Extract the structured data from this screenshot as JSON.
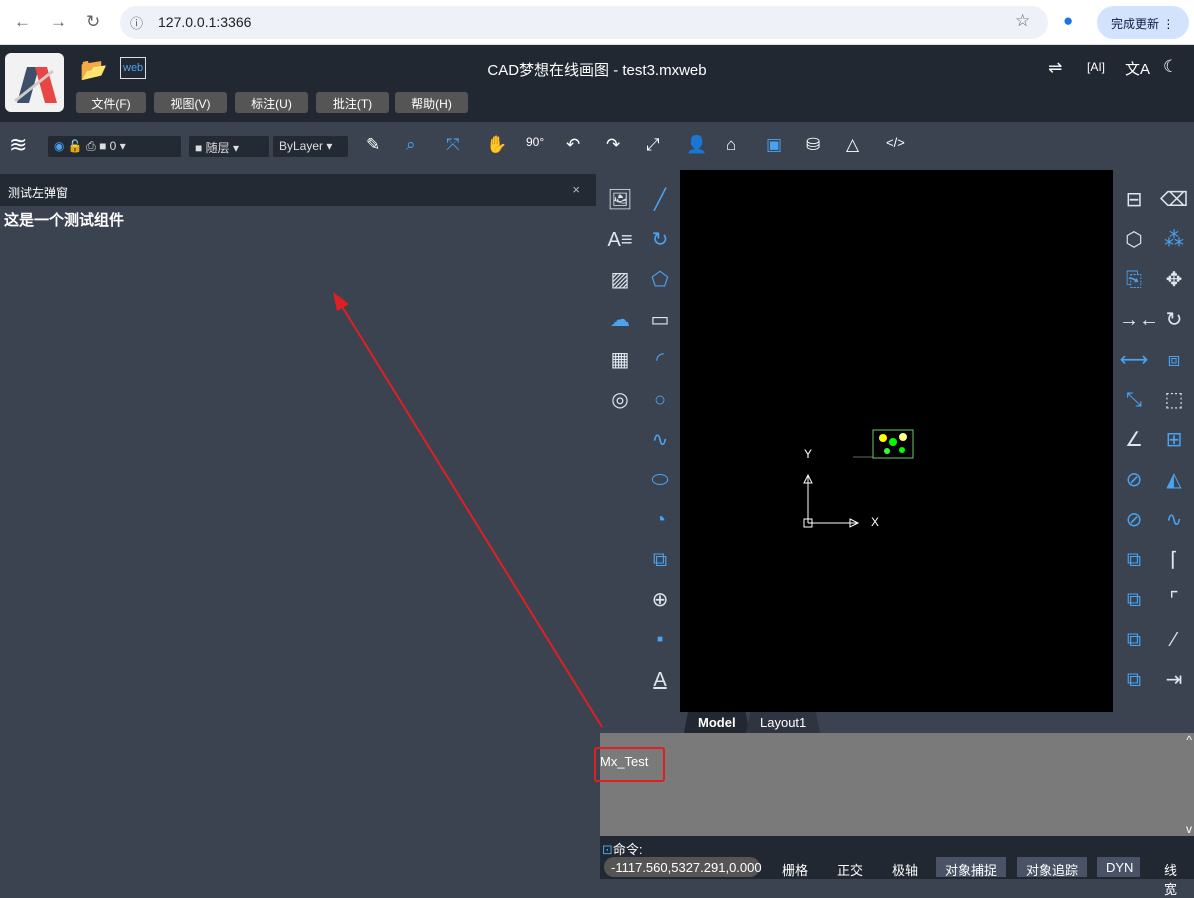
{
  "browser": {
    "url": "127.0.0.1:3366",
    "update_label": "完成更新"
  },
  "header": {
    "title": "CAD梦想在线画图 - test3.mxweb",
    "menus": [
      "文件(F)",
      "视图(V)",
      "标注(U)",
      "批注(T)",
      "帮助(H)"
    ]
  },
  "toolbar": {
    "layer_value": "0",
    "color_value": "随层",
    "linetype_value": "ByLayer"
  },
  "left_panel": {
    "title": "测试左弹窗",
    "content": "这是一个测试组件",
    "close": "×"
  },
  "canvas": {
    "axis_x": "X",
    "axis_y": "Y"
  },
  "layout_tabs": [
    "Model",
    "Layout1"
  ],
  "command": {
    "history": "Mx_Test",
    "prompt": "命令:"
  },
  "status": {
    "coords": "-1117.560,5327.291,0.000",
    "toggles": [
      {
        "label": "栅格",
        "on": false
      },
      {
        "label": "正交",
        "on": false
      },
      {
        "label": "极轴",
        "on": false
      },
      {
        "label": "对象捕捉",
        "on": true
      },
      {
        "label": "对象追踪",
        "on": true
      },
      {
        "label": "DYN",
        "on": true
      },
      {
        "label": "线宽",
        "on": false
      }
    ]
  },
  "colors": {
    "header": "#222831",
    "panel": "#3b4250",
    "canvas": "#000000",
    "annotation": "#e02020"
  }
}
